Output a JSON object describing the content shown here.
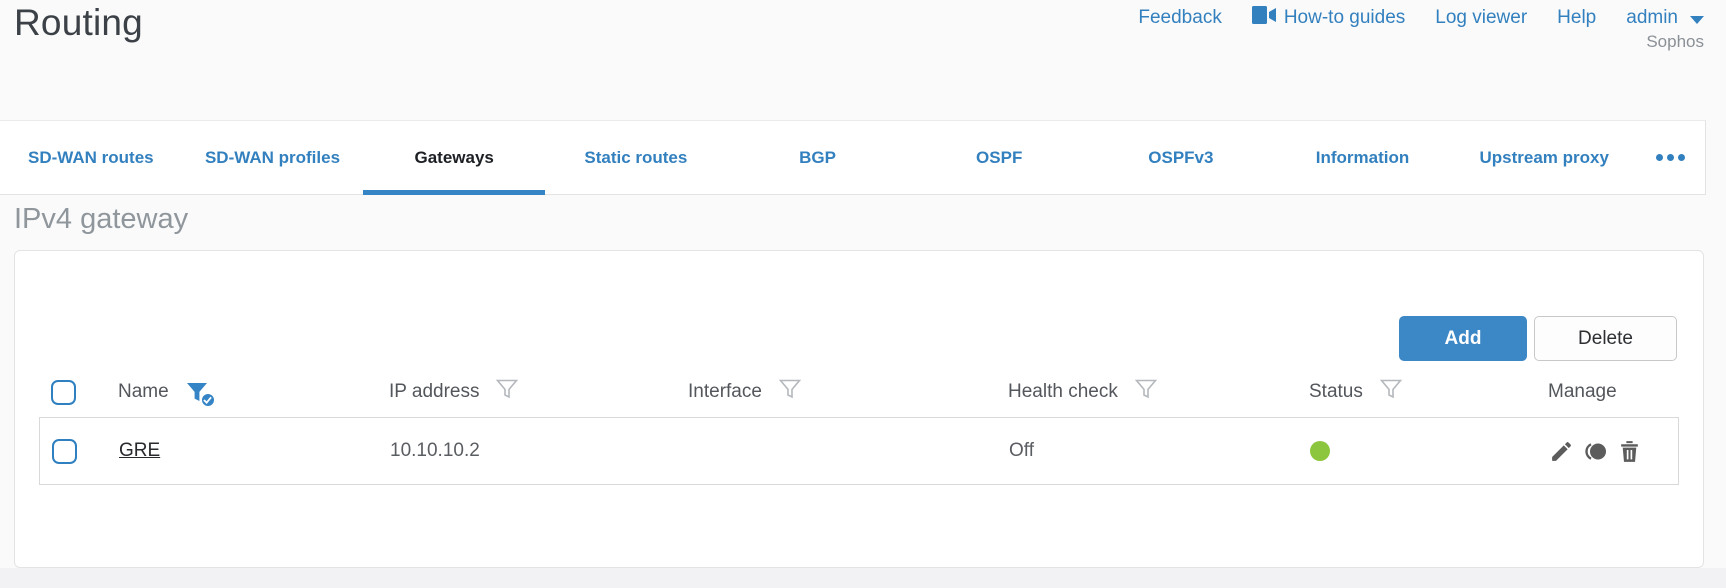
{
  "title": "Routing",
  "brand": "Sophos",
  "nav": {
    "feedback": "Feedback",
    "howto_guides": "How-to guides",
    "log_viewer": "Log viewer",
    "help": "Help",
    "user": "admin"
  },
  "tabs": [
    {
      "label": "SD-WAN routes",
      "active": false
    },
    {
      "label": "SD-WAN profiles",
      "active": false
    },
    {
      "label": "Gateways",
      "active": true
    },
    {
      "label": "Static routes",
      "active": false
    },
    {
      "label": "BGP",
      "active": false
    },
    {
      "label": "OSPF",
      "active": false
    },
    {
      "label": "OSPFv3",
      "active": false
    },
    {
      "label": "Information",
      "active": false
    },
    {
      "label": "Upstream proxy",
      "active": false
    }
  ],
  "section_heading": "IPv4 gateway",
  "toolbar": {
    "add_label": "Add",
    "delete_label": "Delete"
  },
  "table": {
    "columns": [
      {
        "label": "Name",
        "filter": "active"
      },
      {
        "label": "IP address",
        "filter": "default"
      },
      {
        "label": "Interface",
        "filter": "default"
      },
      {
        "label": "Health check",
        "filter": "default"
      },
      {
        "label": "Status",
        "filter": "default"
      },
      {
        "label": "Manage",
        "filter": "none"
      }
    ],
    "rows": [
      {
        "name": "GRE",
        "ip_address": "10.10.10.2",
        "interface": "",
        "health_check": "Off",
        "status": "up"
      }
    ]
  },
  "colors": {
    "accent": "#3c87c5",
    "link_blue": "#3380bf",
    "status_green": "#8cc63e"
  }
}
